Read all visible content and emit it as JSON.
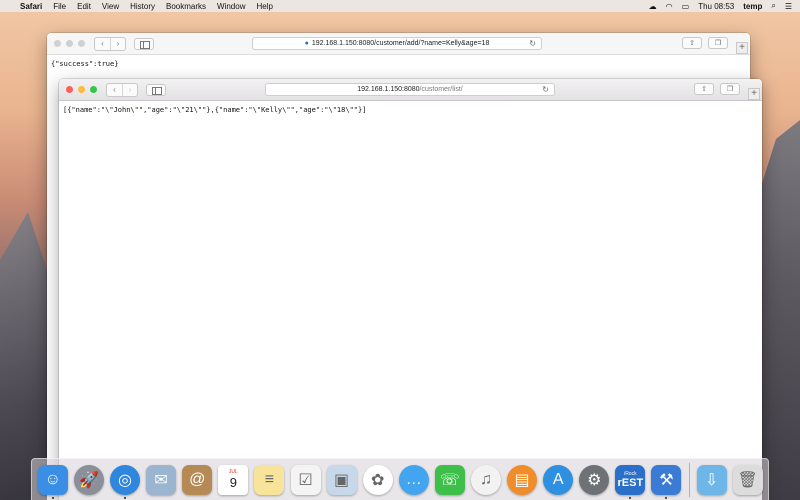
{
  "menubar": {
    "app_name": "Safari",
    "items": [
      "File",
      "Edit",
      "View",
      "History",
      "Bookmarks",
      "Window",
      "Help"
    ],
    "clock": "Thu 08:53",
    "user": "temp"
  },
  "back_window": {
    "url": "192.168.1.150:8080/customer/add/?name=Kelly&age=18",
    "body": "{\"success\":true}"
  },
  "front_window": {
    "url_host": "192.168.1.150:8080",
    "url_path": "/customer/list/",
    "body": "[{\"name\":\"\\\"John\\\"\",\"age\":\"\\\"21\\\"\"},{\"name\":\"\\\"Kelly\\\"\",\"age\":\"\\\"18\\\"\"}]"
  },
  "dock": {
    "calendar": {
      "month": "JUL",
      "day": "9"
    },
    "rest_app": {
      "top": "iRock",
      "big": "rEST"
    },
    "apps": [
      {
        "name": "finder",
        "color": "#3a8ee6",
        "glyph": "☺",
        "running": true
      },
      {
        "name": "launchpad",
        "color": "#8a8f99",
        "glyph": "🚀",
        "running": false
      },
      {
        "name": "safari",
        "color": "#2e86de",
        "glyph": "◎",
        "running": true
      },
      {
        "name": "mail",
        "color": "#9bb4cf",
        "glyph": "✉",
        "running": false
      },
      {
        "name": "contacts",
        "color": "#b58a55",
        "glyph": "@",
        "running": false
      },
      {
        "name": "calendar",
        "color": "#ffffff",
        "glyph": "",
        "running": false
      },
      {
        "name": "notes",
        "color": "#f7e49a",
        "glyph": "≡",
        "running": false
      },
      {
        "name": "reminders",
        "color": "#f4f4f4",
        "glyph": "☑",
        "running": false
      },
      {
        "name": "preview",
        "color": "#c7d8ea",
        "glyph": "▣",
        "running": false
      },
      {
        "name": "photos",
        "color": "#ffffff",
        "glyph": "✿",
        "running": false
      },
      {
        "name": "messages",
        "color": "#43a4f0",
        "glyph": "…",
        "running": false
      },
      {
        "name": "facetime",
        "color": "#3dbf4a",
        "glyph": "☏",
        "running": false
      },
      {
        "name": "itunes",
        "color": "#f2f2f2",
        "glyph": "♫",
        "running": false
      },
      {
        "name": "ibooks",
        "color": "#f08c2a",
        "glyph": "▤",
        "running": false
      },
      {
        "name": "app-store",
        "color": "#2f8fe0",
        "glyph": "A",
        "running": false
      },
      {
        "name": "system-preferences",
        "color": "#6e7276",
        "glyph": "⚙",
        "running": false
      },
      {
        "name": "rest-client",
        "color": "#2a6fc9",
        "glyph": "",
        "running": true
      },
      {
        "name": "xcode",
        "color": "#3a7bd5",
        "glyph": "⚒",
        "running": true
      }
    ],
    "downloads": {
      "color": "#6fb6e8",
      "glyph": "⇩"
    },
    "trash": {
      "color": "#dcdcdc",
      "glyph": "🗑"
    }
  }
}
